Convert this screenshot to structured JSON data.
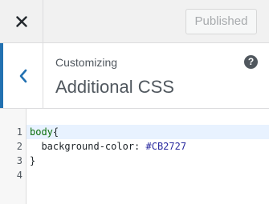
{
  "topbar": {
    "close_icon": "close-icon",
    "publish_label": "Published"
  },
  "header": {
    "back_icon": "chevron-left-icon",
    "breadcrumb": "Customizing",
    "title": "Additional CSS",
    "help_icon": "question-icon",
    "help_glyph": "?"
  },
  "editor": {
    "lines": [
      {
        "number": "1",
        "selector": "body",
        "brace": "{"
      },
      {
        "number": "2",
        "indent": "  ",
        "property": "background-color:",
        "value": " #CB2727"
      },
      {
        "number": "3",
        "brace": "}"
      },
      {
        "number": "4"
      }
    ]
  },
  "colors": {
    "accent": "#2271b1",
    "selector": "#0a6e0a",
    "value": "#2a2a9f",
    "active_line": "#e8f2ff"
  }
}
